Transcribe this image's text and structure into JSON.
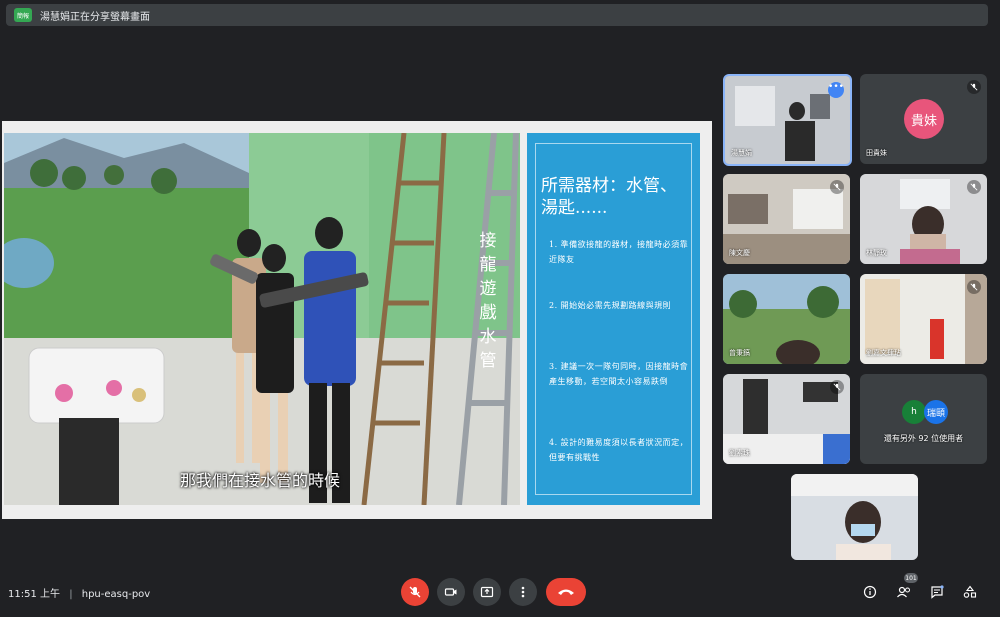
{
  "banner": {
    "badge": "簡報",
    "text": "湯慧娟正在分享螢幕畫面"
  },
  "presentation": {
    "subtitle": "那我們在接水管的時候",
    "vertical_title": "接龍遊戲水管",
    "slide": {
      "title": "所需器材：水管、湯匙......",
      "items": [
        "1. 準備欲接龍的器材，接龍時必須靠近隊友",
        "2. 開始始必需先規劃路線與規則",
        "3. 建議一次一隊句同時，因接龍時會產生移動，若空間太小容易跌倒",
        "4. 設計的難易度須以長者狀況而定，但要有挑戰性"
      ]
    }
  },
  "participants": [
    {
      "name": "湯慧娟",
      "type": "video",
      "active": true
    },
    {
      "name": "田貴妹",
      "type": "avatar",
      "initials": "貴妹",
      "color": "#e8557b"
    },
    {
      "name": "陳文慶",
      "type": "video"
    },
    {
      "name": "林靜玫",
      "type": "video"
    },
    {
      "name": "曾秉鎬",
      "type": "video"
    },
    {
      "name": "劉嘉文肆玷",
      "type": "video"
    },
    {
      "name": "劉素珠",
      "type": "video"
    },
    {
      "name": "還有另外 92 位使用者",
      "type": "others",
      "avatars": [
        "h",
        "瑞頤"
      ]
    },
    {
      "name": "",
      "type": "video"
    }
  ],
  "bottom_bar": {
    "time": "11:51 上午",
    "meeting_code": "hpu-easq-pov",
    "people_count": "101",
    "icons": [
      "mic-off-icon",
      "camera-icon",
      "present-icon",
      "more-icon",
      "end-call-icon",
      "info-icon",
      "people-icon",
      "chat-icon",
      "activities-icon"
    ]
  }
}
